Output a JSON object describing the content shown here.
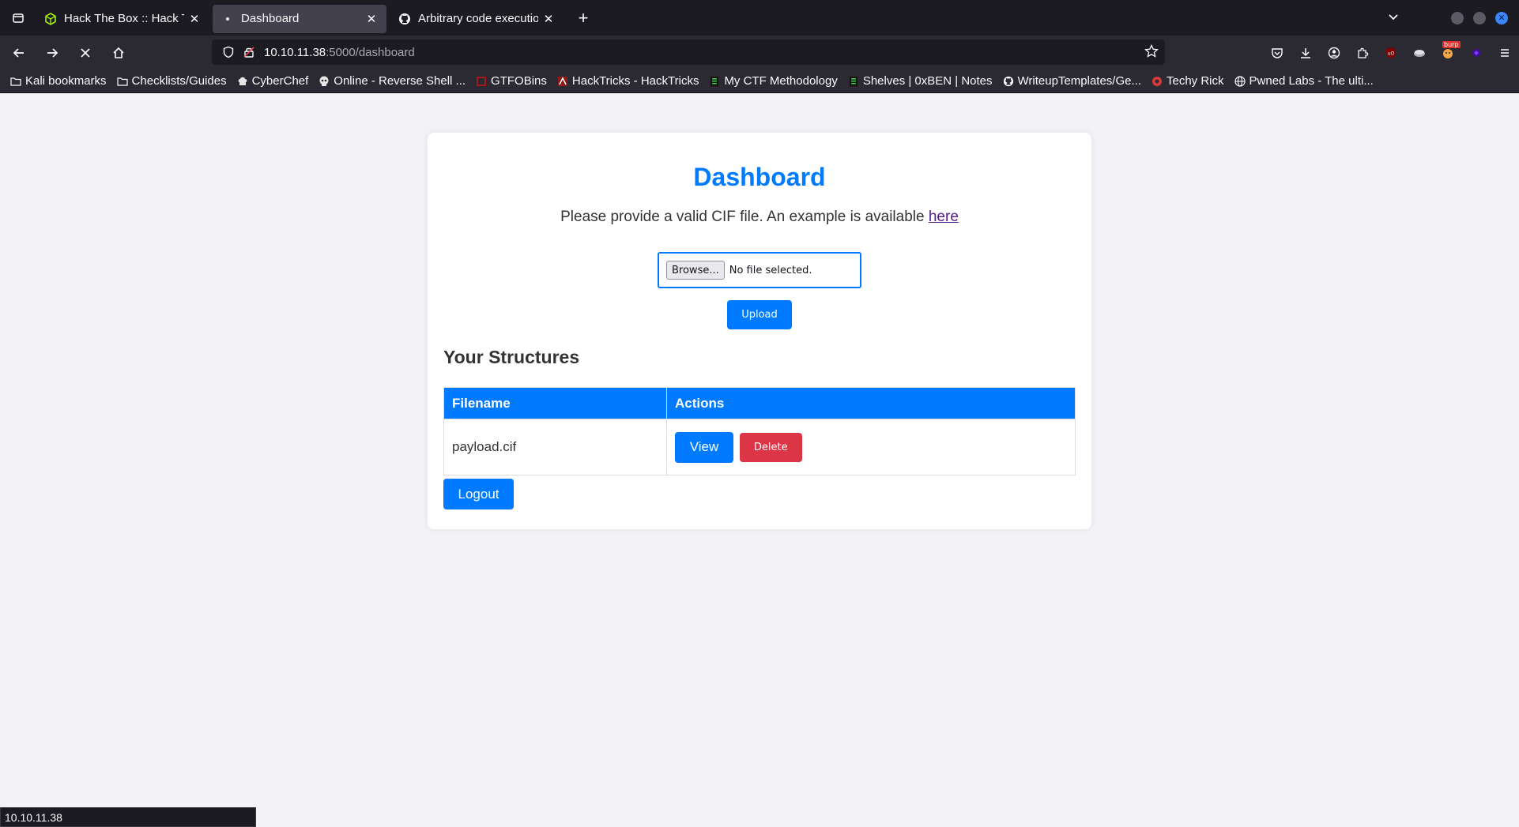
{
  "browser": {
    "tabs": [
      {
        "title": "Hack The Box :: Hack The Box",
        "favicon": "htb-cube-icon"
      },
      {
        "title": "Dashboard",
        "favicon": "dot-icon"
      },
      {
        "title": "Arbitrary code execution via",
        "favicon": "github-icon"
      }
    ],
    "url_host": "10.10.11.38",
    "url_path": ":5000/dashboard",
    "bookmarks": [
      "Kali bookmarks",
      "Checklists/Guides",
      "CyberChef",
      "Online - Reverse Shell ...",
      "GTFOBins",
      "HackTricks - HackTricks",
      "My CTF Methodology",
      "Shelves | 0xBEN | Notes",
      "WriteupTemplates/Ge...",
      "Techy Rick",
      "Pwned Labs - The ulti..."
    ],
    "status_text": "10.10.11.38",
    "burp_badge": "burp"
  },
  "page": {
    "title": "Dashboard",
    "intro_text": "Please provide a valid CIF file. An example is available",
    "intro_link": "here",
    "browse_label": "Browse...",
    "no_file_text": "No file selected.",
    "upload_label": "Upload",
    "structures_heading": "Your Structures",
    "table": {
      "headers": [
        "Filename",
        "Actions"
      ],
      "rows": [
        {
          "filename": "payload.cif",
          "view_label": "View",
          "delete_label": "Delete"
        }
      ]
    },
    "logout_label": "Logout"
  },
  "colors": {
    "accent": "#007bff",
    "danger": "#dc3545",
    "page_bg": "#f2f2f7"
  }
}
